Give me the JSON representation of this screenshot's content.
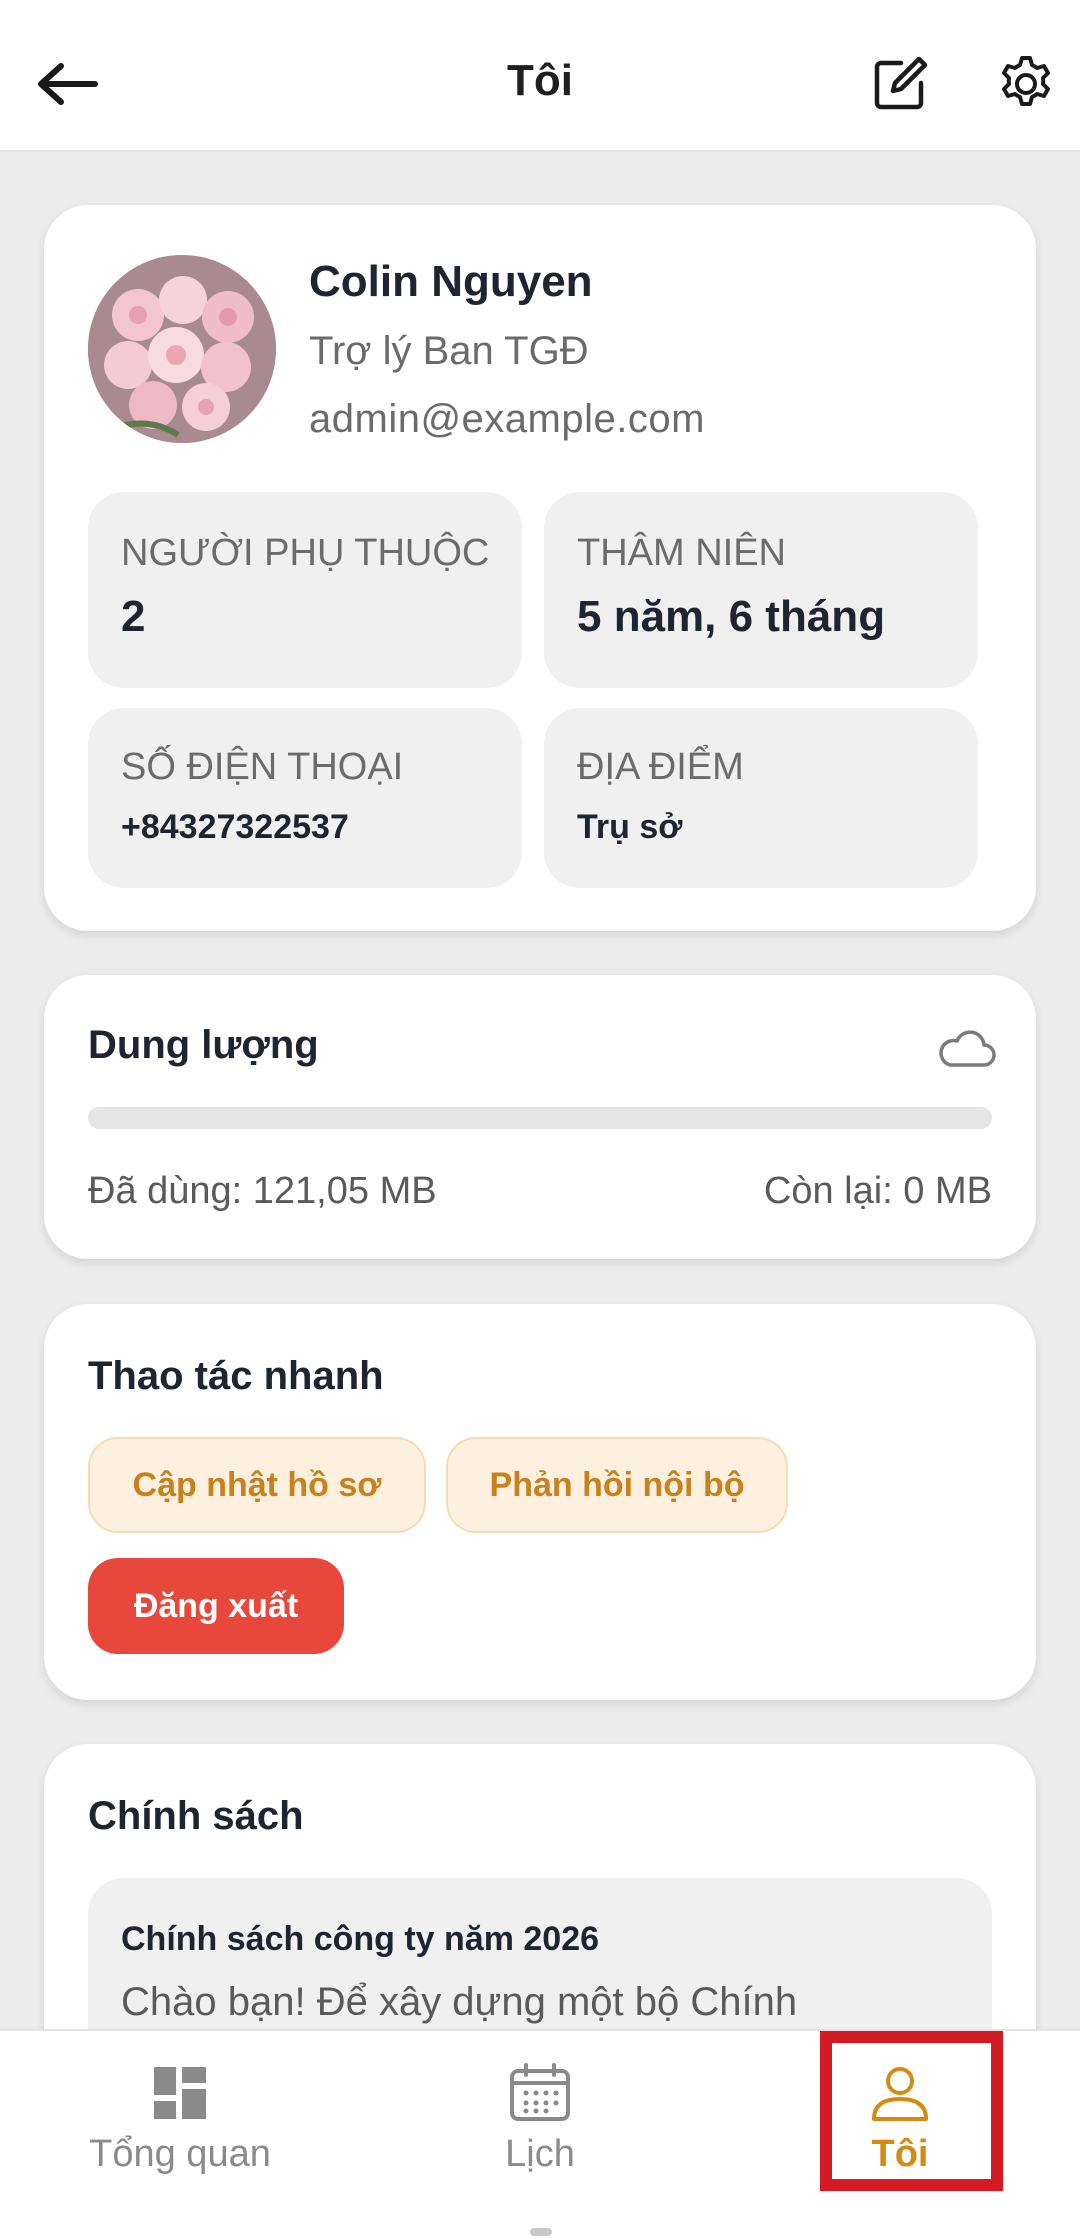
{
  "header": {
    "title": "Tôi"
  },
  "profile": {
    "name": "Colin Nguyen",
    "role": "Trợ lý Ban TGĐ",
    "email": "admin@example.com",
    "info": {
      "dependents_label": "NGƯỜI PHỤ THUỘC",
      "dependents_value": "2",
      "seniority_label": "THÂM NIÊN",
      "seniority_value": "5 năm, 6 tháng",
      "phone_label": "SỐ ĐIỆN THOẠI",
      "phone_value": "+84327322537",
      "location_label": "ĐỊA ĐIỂM",
      "location_value": "Trụ sở"
    }
  },
  "storage": {
    "title": "Dung lượng",
    "used": "Đã dùng: 121,05 MB",
    "remaining": "Còn lại: 0 MB",
    "progress_percent": 0
  },
  "quick_actions": {
    "title": "Thao tác nhanh",
    "update_profile": "Cập nhật hồ sơ",
    "internal_feedback": "Phản hồi nội bộ",
    "logout": "Đăng xuất"
  },
  "policy": {
    "title": "Chính sách",
    "items": [
      {
        "title": "Chính sách công ty năm 2026",
        "snippet": "Chào bạn! Để xây dựng một bộ Chính"
      }
    ]
  },
  "bottom_nav": {
    "items": [
      {
        "label": "Tổng quan",
        "icon": "dashboard-icon"
      },
      {
        "label": "Lịch",
        "icon": "calendar-icon"
      },
      {
        "label": "Tôi",
        "icon": "person-icon",
        "active": true
      }
    ]
  },
  "colors": {
    "accent": "#d68a12",
    "logout": "#e8473b",
    "highlight": "#d41a25"
  }
}
